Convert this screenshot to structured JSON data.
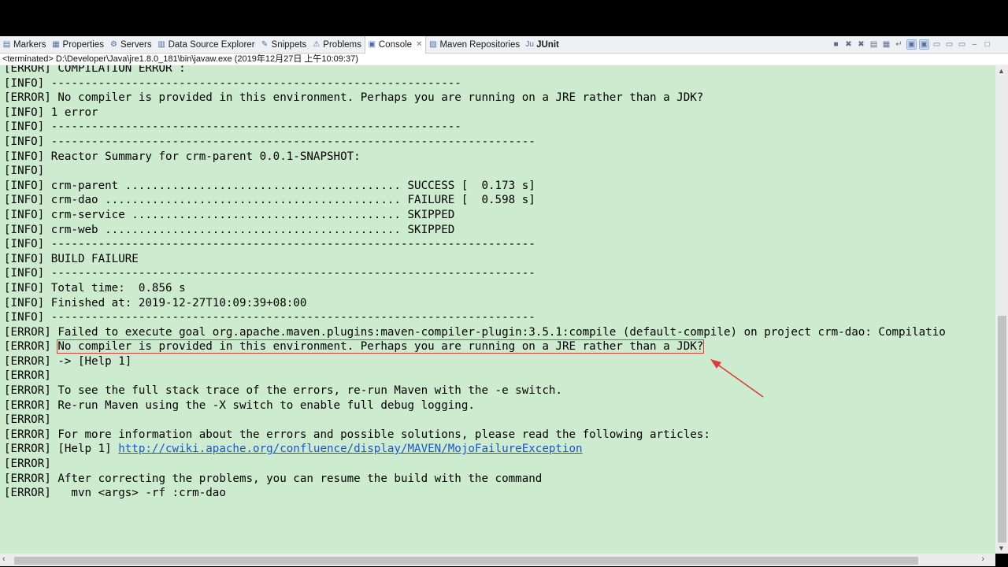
{
  "tabs": [
    {
      "label": "Markers",
      "icon": "markers-icon",
      "glyph": "▤"
    },
    {
      "label": "Properties",
      "icon": "properties-icon",
      "glyph": "▦"
    },
    {
      "label": "Servers",
      "icon": "servers-icon",
      "glyph": "⚙"
    },
    {
      "label": "Data Source Explorer",
      "icon": "data-source-icon",
      "glyph": "▥"
    },
    {
      "label": "Snippets",
      "icon": "snippets-icon",
      "glyph": "✎"
    },
    {
      "label": "Problems",
      "icon": "problems-icon",
      "glyph": "⚠"
    },
    {
      "label": "Console",
      "icon": "console-icon",
      "glyph": "▣",
      "close": "✕"
    },
    {
      "label": "Maven Repositories",
      "icon": "maven-icon",
      "glyph": "▧"
    },
    {
      "label": "JUnit",
      "icon": "junit-icon",
      "glyph": "Ju"
    }
  ],
  "toolbar_icons": [
    "terminate-icon",
    "remove-launch-icon",
    "remove-all-icon",
    "clear-console-icon",
    "scroll-lock-icon",
    "word-wrap-icon",
    "show-on-output-icon",
    "show-on-error-icon",
    "pin-console-icon",
    "display-console-icon",
    "new-console-icon",
    "minimize-icon",
    "maximize-icon"
  ],
  "status": "<terminated> D:\\Developer\\Java\\jre1.8.0_181\\bin\\javaw.exe (2019年12月27日 上午10:09:37)",
  "console": {
    "background": "#cdeccf",
    "lines": [
      "[ERROR] COMPILATION ERROR :",
      "[INFO] -------------------------------------------------------------",
      "[ERROR] No compiler is provided in this environment. Perhaps you are running on a JRE rather than a JDK?",
      "[INFO] 1 error",
      "[INFO] -------------------------------------------------------------",
      "[INFO] ------------------------------------------------------------------------",
      "[INFO] Reactor Summary for crm-parent 0.0.1-SNAPSHOT:",
      "[INFO]",
      "[INFO] crm-parent ......................................... SUCCESS [  0.173 s]",
      "[INFO] crm-dao ............................................ FAILURE [  0.598 s]",
      "[INFO] crm-service ........................................ SKIPPED",
      "[INFO] crm-web ............................................ SKIPPED",
      "[INFO] ------------------------------------------------------------------------",
      "[INFO] BUILD FAILURE",
      "[INFO] ------------------------------------------------------------------------",
      "[INFO] Total time:  0.856 s",
      "[INFO] Finished at: 2019-12-27T10:09:39+08:00",
      "[INFO] ------------------------------------------------------------------------",
      "[ERROR] Failed to execute goal org.apache.maven.plugins:maven-compiler-plugin:3.5.1:compile (default-compile) on project crm-dao: Compilatio",
      {
        "prefix": "[ERROR] ",
        "highlight": "No compiler is provided in this environment. Perhaps you are running on a JRE rather than a JDK?"
      },
      "[ERROR] -> [Help 1]",
      "[ERROR]",
      "[ERROR] To see the full stack trace of the errors, re-run Maven with the -e switch.",
      "[ERROR] Re-run Maven using the -X switch to enable full debug logging.",
      "[ERROR]",
      "[ERROR] For more information about the errors and possible solutions, please read the following articles:",
      {
        "prefix": "[ERROR] [Help 1] ",
        "link": "http://cwiki.apache.org/confluence/display/MAVEN/MojoFailureException"
      },
      "[ERROR]",
      "[ERROR] After correcting the problems, you can resume the build with the command",
      "[ERROR]   mvn <args> -rf :crm-dao"
    ]
  },
  "annotation_color": "#e03a3a"
}
